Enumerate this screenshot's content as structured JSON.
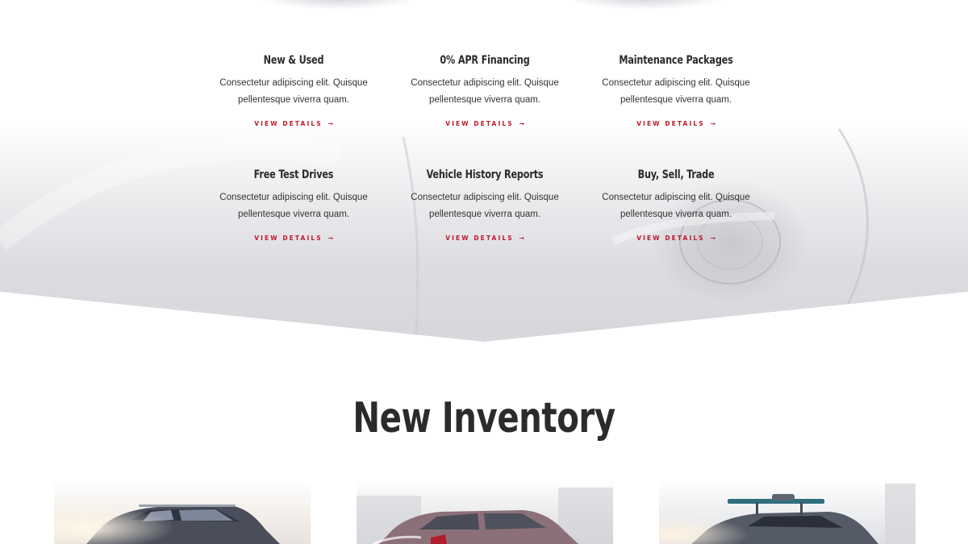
{
  "services": [
    {
      "title": "New & Used",
      "description": "Consectetur adipiscing elit. Quisque pellentesque viverra quam.",
      "link_label": "View Details",
      "arrow": "→"
    },
    {
      "title": "0% APR Financing",
      "description": "Consectetur adipiscing elit. Quisque pellentesque viverra quam.",
      "link_label": "View Details",
      "arrow": "→"
    },
    {
      "title": "Maintenance Packages",
      "description": "Consectetur adipiscing elit. Quisque pellentesque viverra quam.",
      "link_label": "View Details",
      "arrow": "→"
    },
    {
      "title": "Free Test Drives",
      "description": "Consectetur adipiscing elit. Quisque pellentesque viverra quam.",
      "link_label": "View Details",
      "arrow": "→"
    },
    {
      "title": "Vehicle History Reports",
      "description": "Consectetur adipiscing elit. Quisque pellentesque viverra quam.",
      "link_label": "View Details",
      "arrow": "→"
    },
    {
      "title": "Buy, Sell, Trade",
      "description": "Consectetur adipiscing elit. Quisque pellentesque viverra quam.",
      "link_label": "View Details",
      "arrow": "→"
    }
  ],
  "inventory": {
    "heading": "New Inventory",
    "cards": [
      {
        "image": "silver-suv-photo"
      },
      {
        "image": "red-sedan-photo"
      },
      {
        "image": "silver-hatchback-roof-rack-photo"
      }
    ]
  },
  "colors": {
    "accent": "#c0182c",
    "heading": "#2b2b2b",
    "body_text": "#333333"
  }
}
